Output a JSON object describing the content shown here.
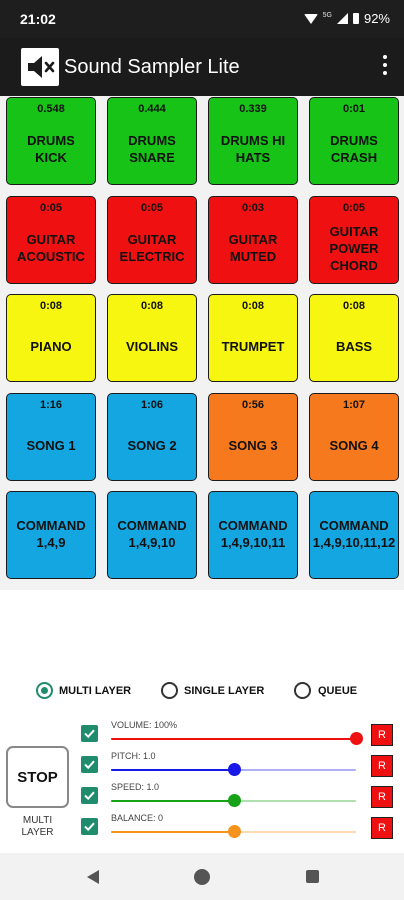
{
  "status_bar": {
    "time": "21:02",
    "network": "5G",
    "battery": "92%"
  },
  "app_bar": {
    "title": "Sound Sampler Lite",
    "icon": "speaker-mute-icon",
    "menu_icon": "more-vert-icon"
  },
  "pads": [
    {
      "duration": "0.548",
      "label": "DRUMS KICK",
      "color": "#16c316"
    },
    {
      "duration": "0.444",
      "label": "DRUMS SNARE",
      "color": "#16c316"
    },
    {
      "duration": "0.339",
      "label": "DRUMS HI HATS",
      "color": "#16c316"
    },
    {
      "duration": "0:01",
      "label": "DRUMS CRASH",
      "color": "#16c316"
    },
    {
      "duration": "0:05",
      "label": "GUITAR ACOUSTIC",
      "color": "#ef1111"
    },
    {
      "duration": "0:05",
      "label": "GUITAR ELECTRIC",
      "color": "#ef1111"
    },
    {
      "duration": "0:03",
      "label": "GUITAR MUTED",
      "color": "#ef1111"
    },
    {
      "duration": "0:05",
      "label": "GUITAR POWER CHORD",
      "color": "#ef1111"
    },
    {
      "duration": "0:08",
      "label": "PIANO",
      "color": "#f6f611"
    },
    {
      "duration": "0:08",
      "label": "VIOLINS",
      "color": "#f6f611"
    },
    {
      "duration": "0:08",
      "label": "TRUMPET",
      "color": "#f6f611"
    },
    {
      "duration": "0:08",
      "label": "BASS",
      "color": "#f6f611"
    },
    {
      "duration": "1:16",
      "label": "SONG 1",
      "color": "#14a6e0"
    },
    {
      "duration": "1:06",
      "label": "SONG 2",
      "color": "#14a6e0"
    },
    {
      "duration": "0:56",
      "label": "SONG 3",
      "color": "#f67a1d"
    },
    {
      "duration": "1:07",
      "label": "SONG 4",
      "color": "#f67a1d"
    },
    {
      "duration": "",
      "label": "COMMAND 1,4,9",
      "color": "#14a6e0"
    },
    {
      "duration": "",
      "label": "COMMAND 1,4,9,10",
      "color": "#14a6e0"
    },
    {
      "duration": "",
      "label": "COMMAND 1,4,9,10,11",
      "color": "#14a6e0"
    },
    {
      "duration": "",
      "label": "COMMAND 1,4,9,10,11,12",
      "color": "#14a6e0"
    }
  ],
  "modes": {
    "selected": "multi",
    "options": [
      {
        "id": "multi",
        "label": "MULTI LAYER"
      },
      {
        "id": "single",
        "label": "SINGLE LAYER"
      },
      {
        "id": "queue",
        "label": "QUEUE"
      }
    ]
  },
  "stop": {
    "label": "STOP",
    "sub_label": "MULTI LAYER"
  },
  "sliders": [
    {
      "label": "VOLUME: 100%",
      "value": 1.0,
      "checked": true,
      "color": "#ef1111",
      "reset": "R"
    },
    {
      "label": "PITCH: 1.0",
      "value": 0.5,
      "checked": true,
      "color": "#1818e8",
      "reset": "R"
    },
    {
      "label": "SPEED: 1.0",
      "value": 0.5,
      "checked": true,
      "color": "#17a317",
      "reset": "R"
    },
    {
      "label": "BALANCE: 0",
      "value": 0.5,
      "checked": true,
      "color": "#f6931d",
      "reset": "R"
    }
  ],
  "accent": "#1f8c6e",
  "nav_icons": [
    "back-icon",
    "home-icon",
    "recents-icon"
  ]
}
